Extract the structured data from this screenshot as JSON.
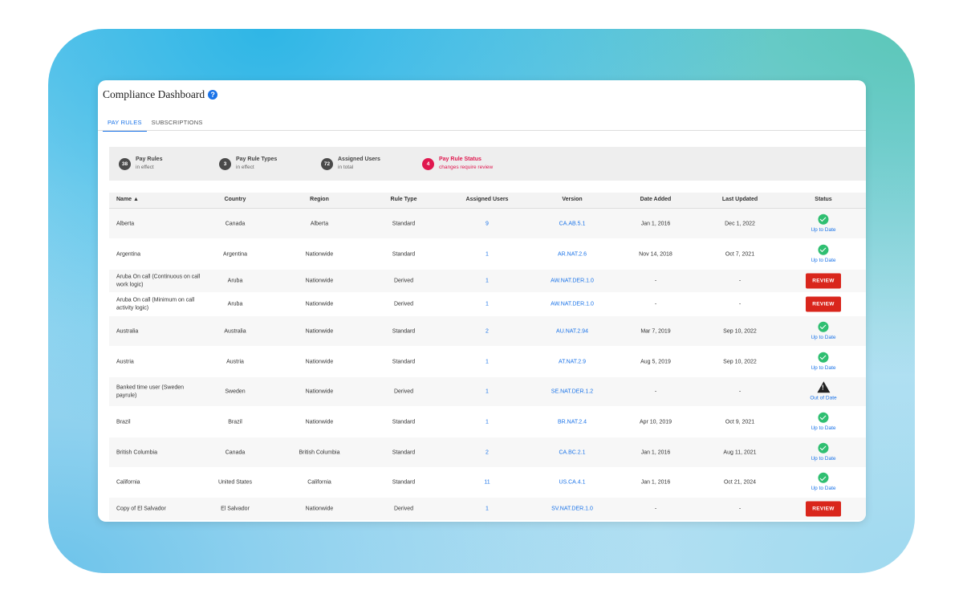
{
  "header": {
    "title": "Compliance Dashboard"
  },
  "tabs": [
    {
      "label": "PAY RULES",
      "active": true
    },
    {
      "label": "SUBSCRIPTIONS",
      "active": false
    }
  ],
  "stats": [
    {
      "count": "38",
      "label": "Pay Rules",
      "sub": "in effect"
    },
    {
      "count": "3",
      "label": "Pay Rule Types",
      "sub": "in effect"
    },
    {
      "count": "72",
      "label": "Assigned Users",
      "sub": "in total"
    },
    {
      "count": "4",
      "label": "Pay Rule Status",
      "sub": "changes require review"
    }
  ],
  "table": {
    "columns": [
      "Name ▲",
      "Country",
      "Region",
      "Rule Type",
      "Assigned Users",
      "Version",
      "Date Added",
      "Last Updated",
      "Status"
    ],
    "rows": [
      {
        "name": "Alberta",
        "country": "Canada",
        "region": "Alberta",
        "type": "Standard",
        "users": "9",
        "version": "CA.AB.5.1",
        "added": "Jan 1, 2016",
        "updated": "Dec 1, 2022",
        "status": "Up to Date"
      },
      {
        "name": "Argentina",
        "country": "Argentina",
        "region": "Nationwide",
        "type": "Standard",
        "users": "1",
        "version": "AR.NAT.2.6",
        "added": "Nov 14, 2018",
        "updated": "Oct 7, 2021",
        "status": "Up to Date"
      },
      {
        "name": "Aruba On call (Continuous on call work logic)",
        "country": "Aruba",
        "region": "Nationwide",
        "type": "Derived",
        "users": "1",
        "version": "AW.NAT.DER.1.0",
        "added": "-",
        "updated": "-",
        "status": "REVIEW"
      },
      {
        "name": "Aruba On call (Minimum on call activity logic)",
        "country": "Aruba",
        "region": "Nationwide",
        "type": "Derived",
        "users": "1",
        "version": "AW.NAT.DER.1.0",
        "added": "-",
        "updated": "-",
        "status": "REVIEW"
      },
      {
        "name": "Australia",
        "country": "Australia",
        "region": "Nationwide",
        "type": "Standard",
        "users": "2",
        "version": "AU.NAT.2.94",
        "added": "Mar 7, 2019",
        "updated": "Sep 10, 2022",
        "status": "Up to Date"
      },
      {
        "name": "Austria",
        "country": "Austria",
        "region": "Nationwide",
        "type": "Standard",
        "users": "1",
        "version": "AT.NAT.2.9",
        "added": "Aug 5, 2019",
        "updated": "Sep 10, 2022",
        "status": "Up to Date"
      },
      {
        "name": "Banked time user (Sweden payrule)",
        "country": "Sweden",
        "region": "Nationwide",
        "type": "Derived",
        "users": "1",
        "version": "SE.NAT.DER.1.2",
        "added": "-",
        "updated": "-",
        "status": "Out of Date"
      },
      {
        "name": "Brazil",
        "country": "Brazil",
        "region": "Nationwide",
        "type": "Standard",
        "users": "1",
        "version": "BR.NAT.2.4",
        "added": "Apr 10, 2019",
        "updated": "Oct 9, 2021",
        "status": "Up to Date"
      },
      {
        "name": "British Columbia",
        "country": "Canada",
        "region": "British Columbia",
        "type": "Standard",
        "users": "2",
        "version": "CA.BC.2.1",
        "added": "Jan 1, 2016",
        "updated": "Aug 11, 2021",
        "status": "Up to Date"
      },
      {
        "name": "California",
        "country": "United States",
        "region": "California",
        "type": "Standard",
        "users": "11",
        "version": "US.CA.4.1",
        "added": "Jan 1, 2016",
        "updated": "Oct 21, 2024",
        "status": "Up to Date"
      },
      {
        "name": "Copy of El Salvador",
        "country": "El Salvador",
        "region": "Nationwide",
        "type": "Derived",
        "users": "1",
        "version": "SV.NAT.DER.1.0",
        "added": "-",
        "updated": "-",
        "status": "REVIEW"
      }
    ]
  }
}
